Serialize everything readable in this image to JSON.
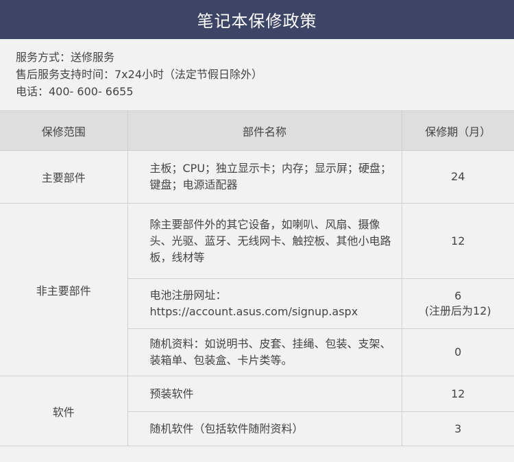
{
  "title": "笔记本保修政策",
  "info": {
    "service_mode": "服务方式：送修服务",
    "support_hours": "售后服务支持时间：7x24小时（法定节假日除外）",
    "phone": "电话：400- 600- 6655"
  },
  "table": {
    "headers": [
      "保修范围",
      "部件名称",
      "保修期（月）"
    ],
    "groups": [
      {
        "category": "主要部件",
        "rows": [
          {
            "parts": "主板；CPU；独立显示卡；内存；显示屏；硬盘；键盘；电源适配器",
            "period": "24"
          }
        ]
      },
      {
        "category": "非主要部件",
        "rows": [
          {
            "parts": "除主要部件外的其它设备，如喇叭、风扇、摄像头、光驱、蓝牙、无线网卡、触控板、其他小电路板，线材等",
            "period": "12"
          },
          {
            "parts_line1": "电池注册网址：",
            "parts_line2": "https://account.asus.com/signup.aspx",
            "period": "6",
            "period_note": "(注册后为12)"
          },
          {
            "parts": "随机资料：如说明书、皮套、挂绳、包装、支架、装箱单、包装盒、卡片类等。",
            "period": "0"
          }
        ]
      },
      {
        "category": "软件",
        "rows": [
          {
            "parts": "预装软件",
            "period": "12"
          },
          {
            "parts": "随机软件（包括软件随附资料）",
            "period": "3"
          }
        ]
      }
    ]
  }
}
